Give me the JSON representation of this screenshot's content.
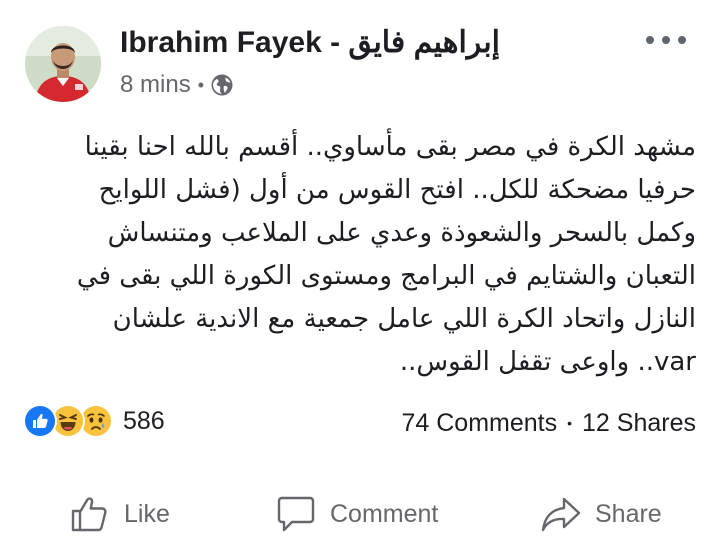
{
  "post": {
    "author": "Ibrahim Fayek - إبراهيم فايق",
    "time": "8 mins",
    "separator": "•",
    "privacy_icon": "globe-icon",
    "more_icon": "more-options-icon",
    "text_lines": [
      "مشهد الكرة في مصر بقى مأساوي.. أقسم بالله احنا بقينا",
      "حرفيا مضحكة للكل.. افتح القوس من أول (فشل اللوايح",
      "وكمل بالسحر والشعوذة وعدي على الملاعب ومتنساش",
      "التعبان والشتايم في البرامج ومستوى الكورة اللي بقى في",
      "النازل واتحاد الكرة اللي عامل جمعية مع الاندية علشان",
      "var.. واوعى تقفل القوس.."
    ]
  },
  "reactions": {
    "icons": [
      "like-reaction-icon",
      "haha-reaction-icon",
      "sad-reaction-icon"
    ],
    "count": "586"
  },
  "stats": {
    "comments": "74 Comments",
    "separator": "•",
    "shares": "12 Shares"
  },
  "actions": {
    "like": "Like",
    "comment": "Comment",
    "share": "Share"
  },
  "colors": {
    "text": "#1c1e21",
    "secondary": "#65676b",
    "like_blue": "#1877f2",
    "emoji_yellow": "#f7c23c"
  }
}
